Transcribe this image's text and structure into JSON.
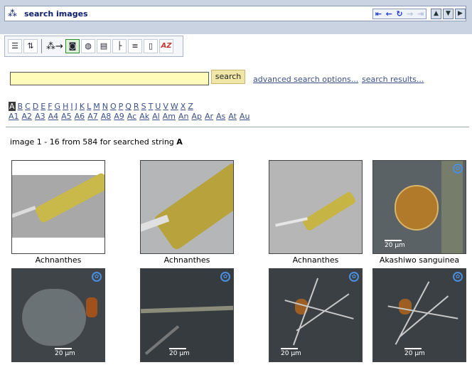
{
  "window": {
    "title": "search images",
    "nav_icons": [
      "first-icon",
      "back-icon",
      "refresh-icon",
      "forward-icon",
      "last-icon"
    ],
    "window_icons": [
      "scroll-up-icon",
      "scroll-down-icon",
      "close-panel-icon"
    ]
  },
  "toolbar": {
    "buttons": [
      "list-icon",
      "sort-icon",
      "binoculars-arrow-icon",
      "camera-icon",
      "globe-icon",
      "book-icon",
      "tree-icon",
      "list-view-icon",
      "document-icon",
      "az-icon"
    ],
    "az_label": "AZ"
  },
  "search": {
    "value": "",
    "button_label": "search",
    "advanced_link": "advanced search options...",
    "results_link": "search results..."
  },
  "alphabet": {
    "selected": "A",
    "letters": [
      "A",
      "B",
      "C",
      "D",
      "E",
      "F",
      "G",
      "H",
      "I",
      "J",
      "K",
      "L",
      "M",
      "N",
      "O",
      "P",
      "Q",
      "R",
      "S",
      "T",
      "U",
      "V",
      "W",
      "X",
      "Z"
    ],
    "sub_prefixes": [
      "A1",
      "A2",
      "A3",
      "A4",
      "A5",
      "A6",
      "A7",
      "A8",
      "A9",
      "Ac",
      "Ak",
      "Al",
      "Am",
      "An",
      "Ap",
      "Ar",
      "As",
      "At",
      "Au"
    ]
  },
  "results": {
    "info_prefix": "image 1 - 16 from 584 for searched string ",
    "search_string": "A"
  },
  "images": [
    {
      "caption": "Achnanthes",
      "scale": ""
    },
    {
      "caption": "Achnanthes",
      "scale": ""
    },
    {
      "caption": "Achnanthes",
      "scale": ""
    },
    {
      "caption": "Akashiwo sanguinea",
      "scale": "20 µm"
    },
    {
      "caption": "",
      "scale": "20 µm"
    },
    {
      "caption": "",
      "scale": "20 µm"
    },
    {
      "caption": "",
      "scale": "20 µm"
    },
    {
      "caption": "",
      "scale": "20 µm"
    }
  ],
  "colors": {
    "titlebar_bg": "#c9d3e1",
    "link": "#3b4f8a",
    "input_bg": "#fffbb8",
    "search_btn_bg": "#f0e6a8"
  }
}
